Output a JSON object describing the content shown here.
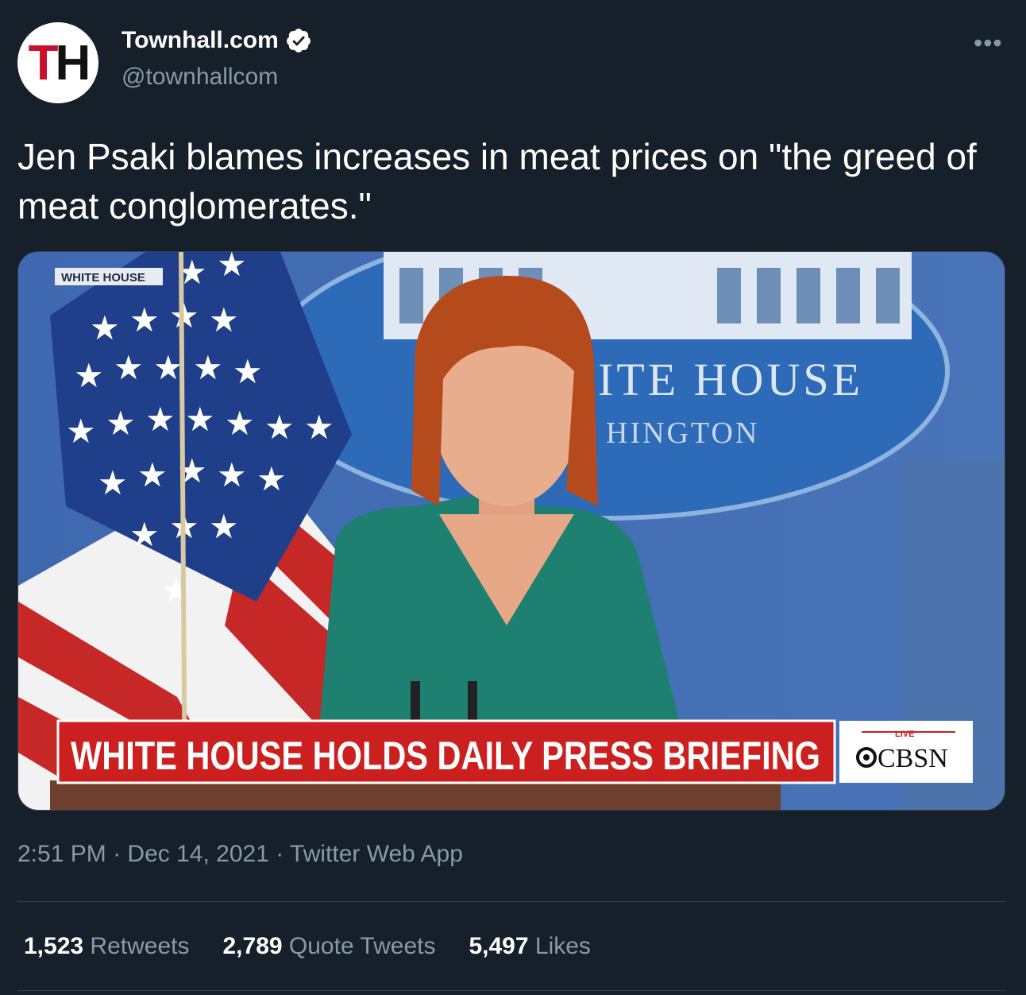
{
  "account": {
    "avatar_letters": [
      "T",
      "H"
    ],
    "display_name": "Townhall.com",
    "handle": "@townhallcom",
    "verified": true
  },
  "more_icon": "•••",
  "tweet": {
    "text": "Jen Psaki blames increases in meat prices on \"the greed of meat conglomerates.\""
  },
  "media": {
    "corner_label": "WHITE HOUSE",
    "seal_line1": "ITE HOUSE",
    "seal_line2": "HINGTON",
    "lower_third": "WHITE HOUSE HOLDS DAILY PRESS BRIEFING",
    "network_live": "LIVE",
    "network_name": "CBSN"
  },
  "meta": {
    "time": "2:51 PM",
    "date": "Dec 14, 2021",
    "source": "Twitter Web App",
    "separator": "·"
  },
  "stats": [
    {
      "count": "1,523",
      "label": "Retweets"
    },
    {
      "count": "2,789",
      "label": "Quote Tweets"
    },
    {
      "count": "5,497",
      "label": "Likes"
    }
  ],
  "colors": {
    "background": "#15202b",
    "secondary_text": "#8b98a5",
    "divider": "#38444d",
    "verified": "#ffffff",
    "brand_red": "#c8102e",
    "banner_red": "#cc1f1f"
  }
}
